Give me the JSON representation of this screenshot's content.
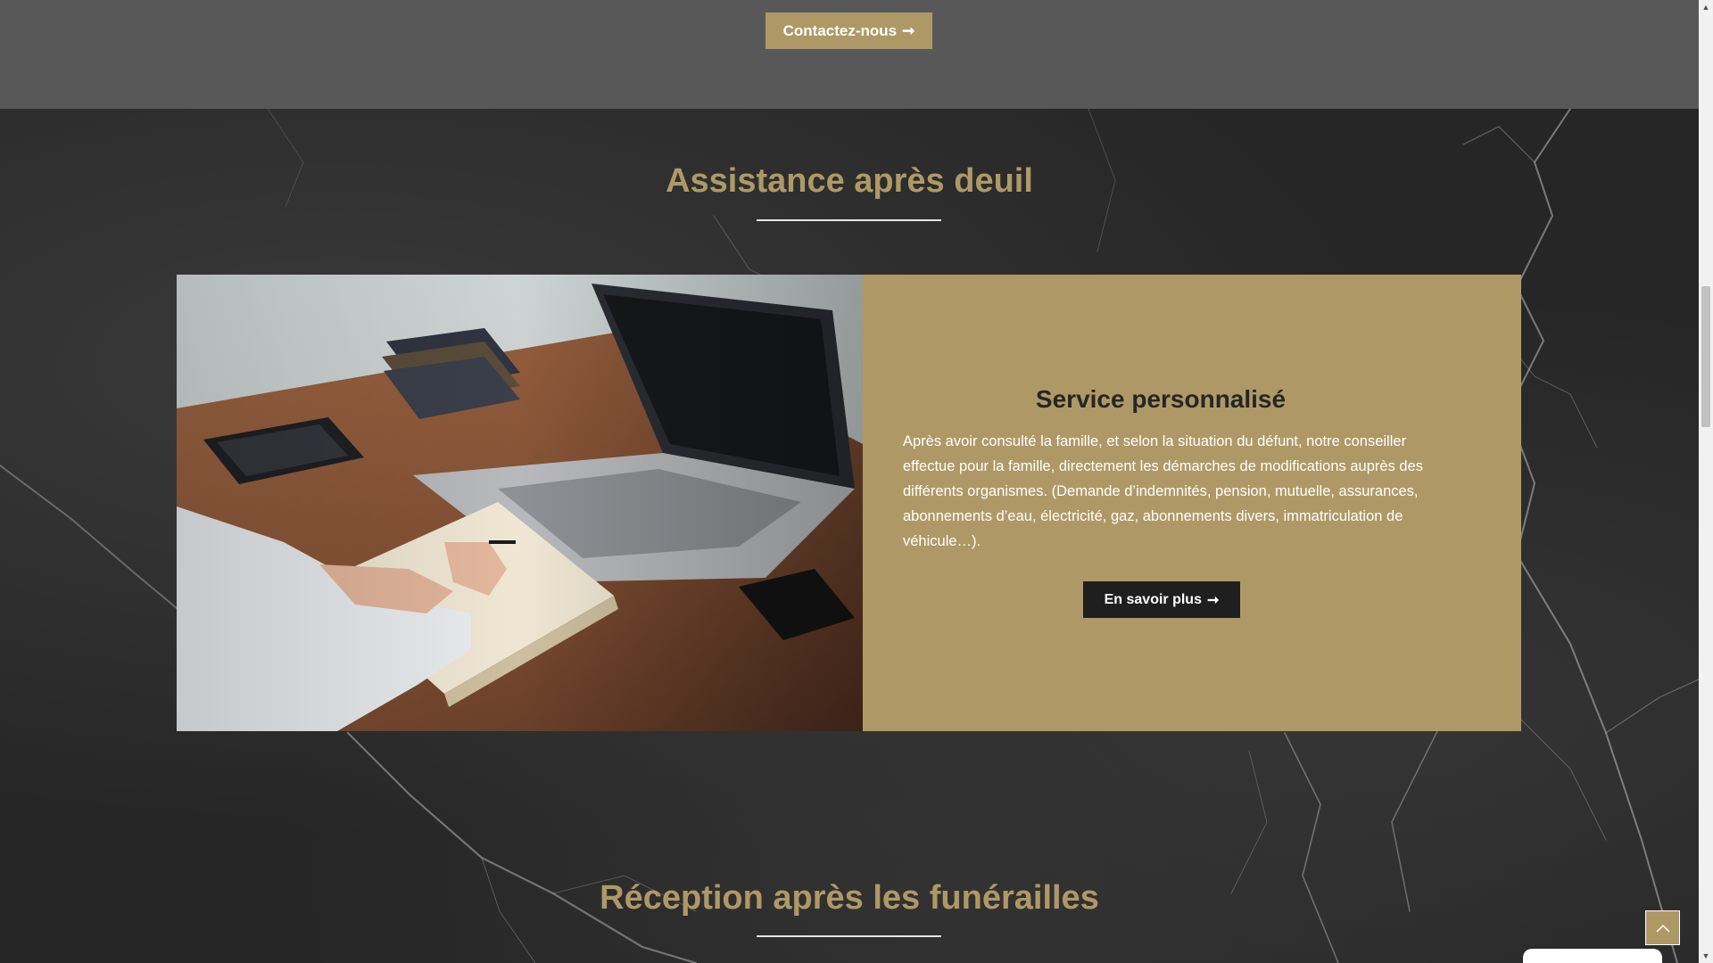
{
  "top_band": {
    "contact_label": "Contactez-nous",
    "arrow": "➞"
  },
  "assistance": {
    "title": "Assistance après deuil",
    "card": {
      "heading": "Service personnalisé",
      "text": "Après avoir consulté la famille, et selon la situation du défunt, notre conseiller effectue pour la famille, directement les démarches de modifications auprès des différents organismes. (Demande d’indemnités, pension, mutuelle, assurances, abonnements d’eau, électricité, gaz, abonnements divers, immatriculation de véhicule…).",
      "button_label": "En savoir plus",
      "arrow": "➞"
    }
  },
  "reception": {
    "title": "Réception après les funérailles"
  },
  "colors": {
    "accent": "#ae9966",
    "top_band": "#585858",
    "dark_button": "#1f1f1f",
    "marble": "#262626"
  },
  "icons": {
    "back_to_top": "chevron-up-icon",
    "contact_arrow": "arrow-right-icon"
  }
}
